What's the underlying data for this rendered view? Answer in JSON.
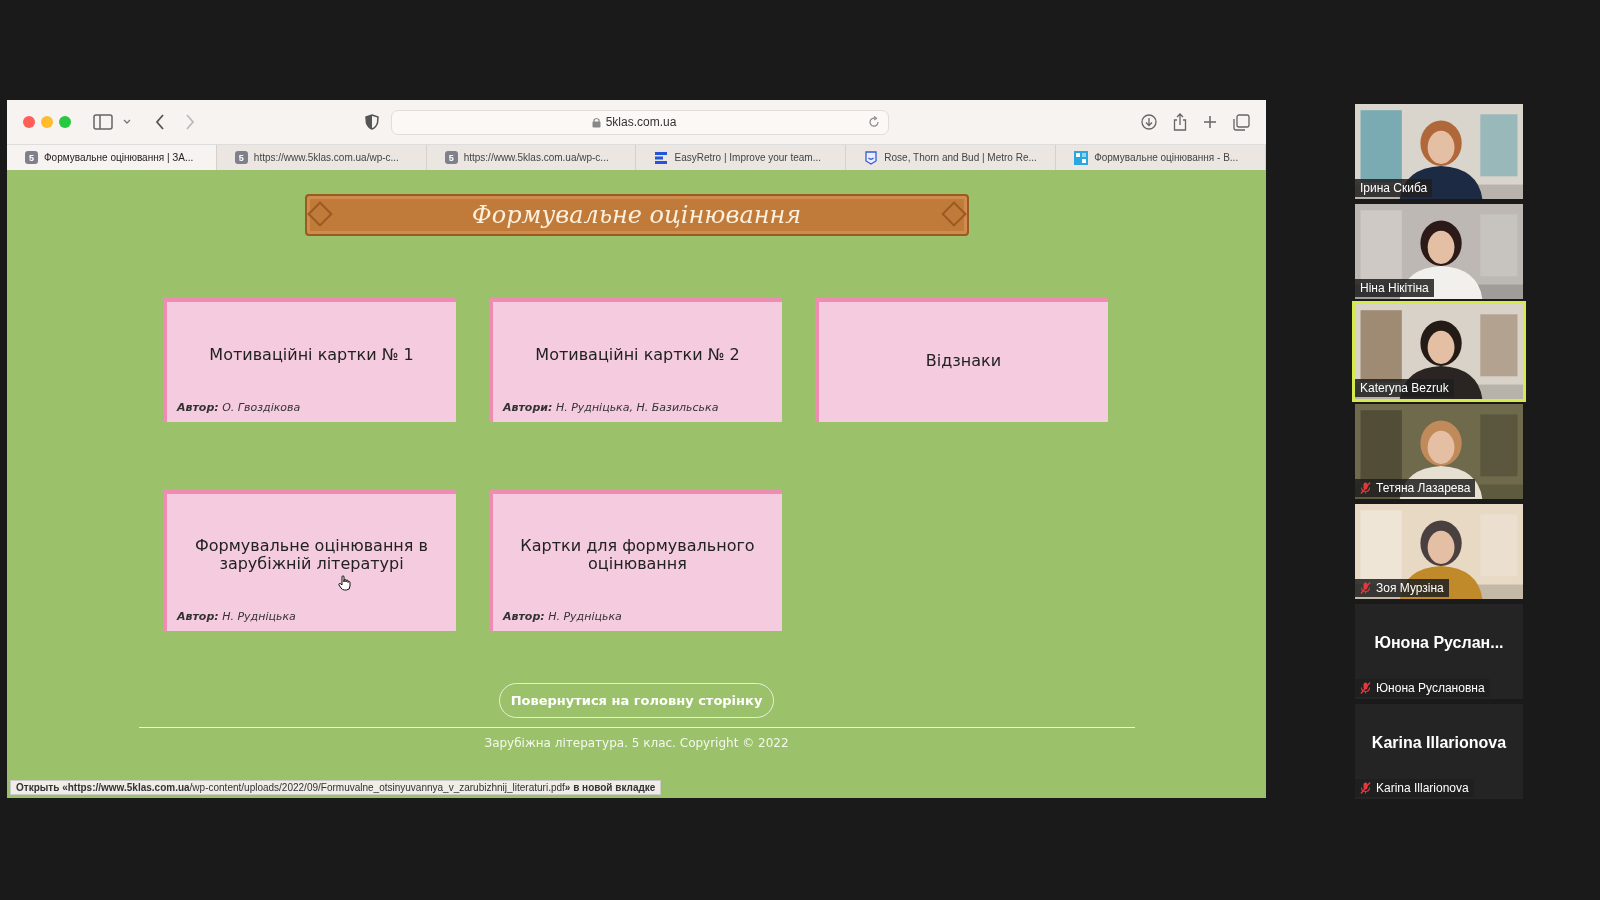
{
  "browser": {
    "address": "5klas.com.ua",
    "tabs": [
      {
        "label": "Формувальне оцінювання | ЗА...",
        "selected": true,
        "kind": "letter",
        "icon_text": "5"
      },
      {
        "label": "https://www.5klas.com.ua/wp-c...",
        "selected": false,
        "kind": "letter",
        "icon_text": "5"
      },
      {
        "label": "https://www.5klas.com.ua/wp-c...",
        "selected": false,
        "kind": "letter",
        "icon_text": "5"
      },
      {
        "label": "EasyRetro | Improve your team...",
        "selected": false,
        "kind": "bars"
      },
      {
        "label": "Rose, Thorn and Bud | Metro Re...",
        "selected": false,
        "kind": "badge"
      },
      {
        "label": "Формувальне оцінювання - В...",
        "selected": false,
        "kind": "grid"
      }
    ]
  },
  "page": {
    "title": "Формувальне оцінювання",
    "cards": [
      {
        "title": "Мотиваційні картки № 1",
        "author": "**Автор:** О. Гвоздікова"
      },
      {
        "title": "Мотиваційні картки № 2",
        "author": "**Автори:** Н. Рудніцька, Н. Базильська"
      },
      {
        "title": "Відзнаки"
      },
      {
        "title": "Формувальне оцінювання в зарубіжній літературі",
        "author": "**Автор:** Н. Рудніцька"
      },
      {
        "title": "Картки для формувального оцінювання",
        "author": "**Автор:** Н. Рудніцька"
      }
    ],
    "back_button": "Повернутися на головну сторінку",
    "footer": "Зарубіжна література. 5 клас. Copyright © 2022"
  },
  "status_bar": "**Открыть «https://www.5klas.com.ua**/wp-content/uploads/2022/09/Formuvalne_otsinyuvannya_v_zarubizhnij_literaturi.pdf**» в новой вкладке**",
  "participants": [
    {
      "kind": "video",
      "name": "Ірина Скиба",
      "muted": false,
      "speaking": false
    },
    {
      "kind": "video",
      "name": "Ніна Нікітіна",
      "muted": false,
      "speaking": false
    },
    {
      "kind": "video",
      "name": "Kateryna Bezruk",
      "muted": false,
      "speaking": true
    },
    {
      "kind": "video",
      "name": "Тетяна Лазарева",
      "muted": true,
      "speaking": false
    },
    {
      "kind": "video",
      "name": "Зоя Мурзіна",
      "muted": true,
      "speaking": false
    },
    {
      "kind": "name",
      "display_name": "Юнона  Руслан...",
      "name": "Юнона Руслановна",
      "muted": true,
      "speaking": false
    },
    {
      "kind": "name",
      "display_name": "Karina Illarionova",
      "name": "Karina Illarionova",
      "muted": true,
      "speaking": false
    }
  ]
}
